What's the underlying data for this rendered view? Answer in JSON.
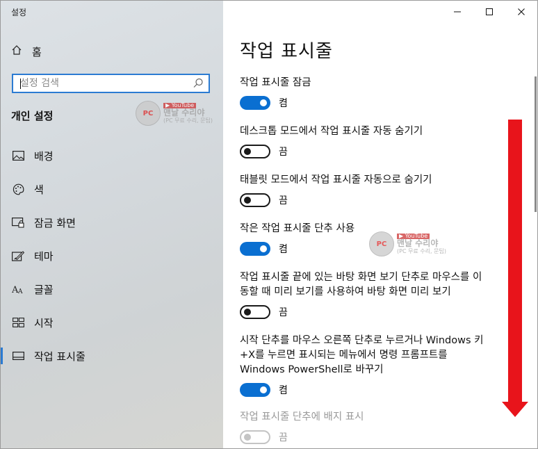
{
  "window": {
    "title": "설정"
  },
  "sidebar": {
    "home_label": "홈",
    "search_placeholder": "설정 검색",
    "section_title": "개인 설정",
    "items": [
      {
        "label": "배경",
        "icon": "picture-icon"
      },
      {
        "label": "색",
        "icon": "palette-icon"
      },
      {
        "label": "잠금 화면",
        "icon": "lock-screen-icon"
      },
      {
        "label": "테마",
        "icon": "theme-icon"
      },
      {
        "label": "글꼴",
        "icon": "font-icon"
      },
      {
        "label": "시작",
        "icon": "start-icon"
      },
      {
        "label": "작업 표시줄",
        "icon": "taskbar-icon",
        "active": true
      }
    ]
  },
  "watermark": {
    "badge": "PC",
    "youtube": "▶ YouTube",
    "name": "맨날 수리야",
    "sub": "(PC 무료 수리, 문팁)"
  },
  "main": {
    "title": "작업 표시줄",
    "settings": [
      {
        "label": "작업 표시줄 잠금",
        "state": "켬",
        "on": true
      },
      {
        "label": "데스크톱 모드에서 작업 표시줄 자동 숨기기",
        "state": "끔",
        "on": false
      },
      {
        "label": "태블릿 모드에서 작업 표시줄 자동으로 숨기기",
        "state": "끔",
        "on": false
      },
      {
        "label": "작은 작업 표시줄 단추 사용",
        "state": "켬",
        "on": true
      },
      {
        "label_line1": "작업 표시줄 끝에 있는 바탕 화면 보기 단추로 마우스를 이",
        "label_line2": "동할 때 미리 보기를 사용하여 바탕 화면 미리 보기",
        "state": "끔",
        "on": false
      },
      {
        "label_line1": "시작 단추를 마우스 오른쪽 단추로 누르거나 Windows 키",
        "label_line2": "+X를 누르면 표시되는 메뉴에서 명령 프롬프트를",
        "label_line3": "Windows PowerShell로 바꾸기",
        "state": "켬",
        "on": true
      },
      {
        "label": "작업 표시줄 단추에 배지 표시",
        "state": "끔",
        "on": false,
        "disabled": true
      }
    ]
  },
  "colors": {
    "accent": "#0a6fd1",
    "arrow": "#e8141b"
  }
}
